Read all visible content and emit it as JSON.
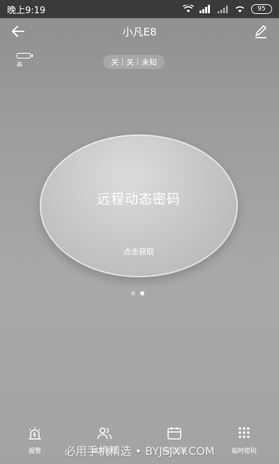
{
  "status_bar": {
    "time": "晚上9:19",
    "battery": "95"
  },
  "header": {
    "title": "小凡E8"
  },
  "lock_battery": {
    "label": "高"
  },
  "lock_status": {
    "items": [
      "关",
      "关",
      "未知"
    ]
  },
  "main": {
    "title": "远程动态密码",
    "action": "点击获取"
  },
  "pager": {
    "count": 2,
    "active": 1
  },
  "nav": {
    "items": [
      {
        "label": "报警",
        "icon": "alarm-icon"
      },
      {
        "label": "成员管理",
        "icon": "users-icon"
      },
      {
        "label": "开门记录",
        "icon": "calendar-icon"
      },
      {
        "label": "临时密码",
        "icon": "keypad-icon"
      }
    ]
  },
  "watermark": "必用手机精选 • BYJSJXY.COM"
}
